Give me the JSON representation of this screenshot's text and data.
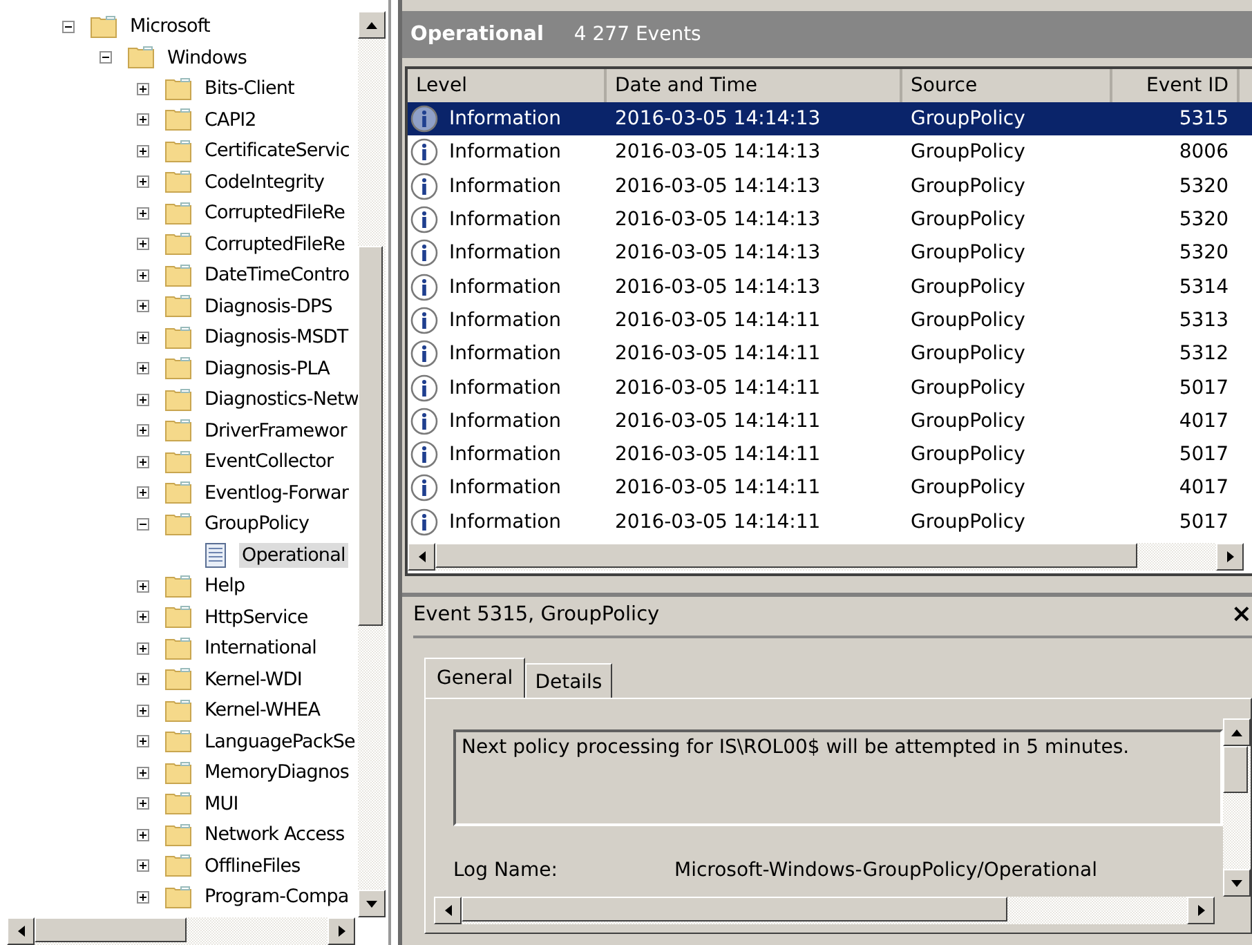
{
  "tree": [
    {
      "label": "Microsoft",
      "kind": "folder",
      "expanded": true,
      "selected": false,
      "children": [
        {
          "label": "Windows",
          "kind": "folder",
          "expanded": true,
          "selected": false,
          "children": [
            {
              "label": "Bits-Client",
              "kind": "folder",
              "expanded": false,
              "selected": false
            },
            {
              "label": "CAPI2",
              "kind": "folder",
              "expanded": false,
              "selected": false
            },
            {
              "label": "CertificateServic",
              "kind": "folder",
              "expanded": false,
              "selected": false
            },
            {
              "label": "CodeIntegrity",
              "kind": "folder",
              "expanded": false,
              "selected": false
            },
            {
              "label": "CorruptedFileRe",
              "kind": "folder",
              "expanded": false,
              "selected": false
            },
            {
              "label": "CorruptedFileRe",
              "kind": "folder",
              "expanded": false,
              "selected": false
            },
            {
              "label": "DateTimeContro",
              "kind": "folder",
              "expanded": false,
              "selected": false
            },
            {
              "label": "Diagnosis-DPS",
              "kind": "folder",
              "expanded": false,
              "selected": false
            },
            {
              "label": "Diagnosis-MSDT",
              "kind": "folder",
              "expanded": false,
              "selected": false
            },
            {
              "label": "Diagnosis-PLA",
              "kind": "folder",
              "expanded": false,
              "selected": false
            },
            {
              "label": "Diagnostics-Netw",
              "kind": "folder",
              "expanded": false,
              "selected": false
            },
            {
              "label": "DriverFramewor",
              "kind": "folder",
              "expanded": false,
              "selected": false
            },
            {
              "label": "EventCollector",
              "kind": "folder",
              "expanded": false,
              "selected": false
            },
            {
              "label": "Eventlog-Forwar",
              "kind": "folder",
              "expanded": false,
              "selected": false
            },
            {
              "label": "GroupPolicy",
              "kind": "folder",
              "expanded": true,
              "selected": false,
              "children": [
                {
                  "label": "Operational",
                  "kind": "log",
                  "selected": true
                }
              ]
            },
            {
              "label": "Help",
              "kind": "folder",
              "expanded": false,
              "selected": false
            },
            {
              "label": "HttpService",
              "kind": "folder",
              "expanded": false,
              "selected": false
            },
            {
              "label": "International",
              "kind": "folder",
              "expanded": false,
              "selected": false
            },
            {
              "label": "Kernel-WDI",
              "kind": "folder",
              "expanded": false,
              "selected": false
            },
            {
              "label": "Kernel-WHEA",
              "kind": "folder",
              "expanded": false,
              "selected": false
            },
            {
              "label": "LanguagePackSe",
              "kind": "folder",
              "expanded": false,
              "selected": false
            },
            {
              "label": "MemoryDiagnos",
              "kind": "folder",
              "expanded": false,
              "selected": false
            },
            {
              "label": "MUI",
              "kind": "folder",
              "expanded": false,
              "selected": false
            },
            {
              "label": "Network Access",
              "kind": "folder",
              "expanded": false,
              "selected": false
            },
            {
              "label": "OfflineFiles",
              "kind": "folder",
              "expanded": false,
              "selected": false
            },
            {
              "label": "Program-Compa",
              "kind": "folder",
              "expanded": false,
              "selected": false
            }
          ]
        }
      ]
    }
  ],
  "log_header": {
    "title": "Operational",
    "count": "4 277 Events"
  },
  "table": {
    "columns": [
      "Level",
      "Date and Time",
      "Source",
      "Event ID"
    ],
    "rows": [
      {
        "level": "Information",
        "date": "2016-03-05 14:14:13",
        "source": "GroupPolicy",
        "event_id": "5315",
        "selected": true
      },
      {
        "level": "Information",
        "date": "2016-03-05 14:14:13",
        "source": "GroupPolicy",
        "event_id": "8006",
        "selected": false
      },
      {
        "level": "Information",
        "date": "2016-03-05 14:14:13",
        "source": "GroupPolicy",
        "event_id": "5320",
        "selected": false
      },
      {
        "level": "Information",
        "date": "2016-03-05 14:14:13",
        "source": "GroupPolicy",
        "event_id": "5320",
        "selected": false
      },
      {
        "level": "Information",
        "date": "2016-03-05 14:14:13",
        "source": "GroupPolicy",
        "event_id": "5320",
        "selected": false
      },
      {
        "level": "Information",
        "date": "2016-03-05 14:14:13",
        "source": "GroupPolicy",
        "event_id": "5314",
        "selected": false
      },
      {
        "level": "Information",
        "date": "2016-03-05 14:14:11",
        "source": "GroupPolicy",
        "event_id": "5313",
        "selected": false
      },
      {
        "level": "Information",
        "date": "2016-03-05 14:14:11",
        "source": "GroupPolicy",
        "event_id": "5312",
        "selected": false
      },
      {
        "level": "Information",
        "date": "2016-03-05 14:14:11",
        "source": "GroupPolicy",
        "event_id": "5017",
        "selected": false
      },
      {
        "level": "Information",
        "date": "2016-03-05 14:14:11",
        "source": "GroupPolicy",
        "event_id": "4017",
        "selected": false
      },
      {
        "level": "Information",
        "date": "2016-03-05 14:14:11",
        "source": "GroupPolicy",
        "event_id": "5017",
        "selected": false
      },
      {
        "level": "Information",
        "date": "2016-03-05 14:14:11",
        "source": "GroupPolicy",
        "event_id": "4017",
        "selected": false
      },
      {
        "level": "Information",
        "date": "2016-03-05 14:14:11",
        "source": "GroupPolicy",
        "event_id": "5017",
        "selected": false
      }
    ]
  },
  "details": {
    "title": "Event 5315, GroupPolicy",
    "close": "×",
    "tabs": [
      {
        "label": "General",
        "selected": true
      },
      {
        "label": "Details",
        "selected": false
      }
    ],
    "message": "Next policy processing for IS\\ROL00$ will be attempted in 5 minutes.",
    "fields": [
      {
        "label": "Log Name:",
        "value": "Microsoft-Windows-GroupPolicy/Operational"
      }
    ]
  }
}
